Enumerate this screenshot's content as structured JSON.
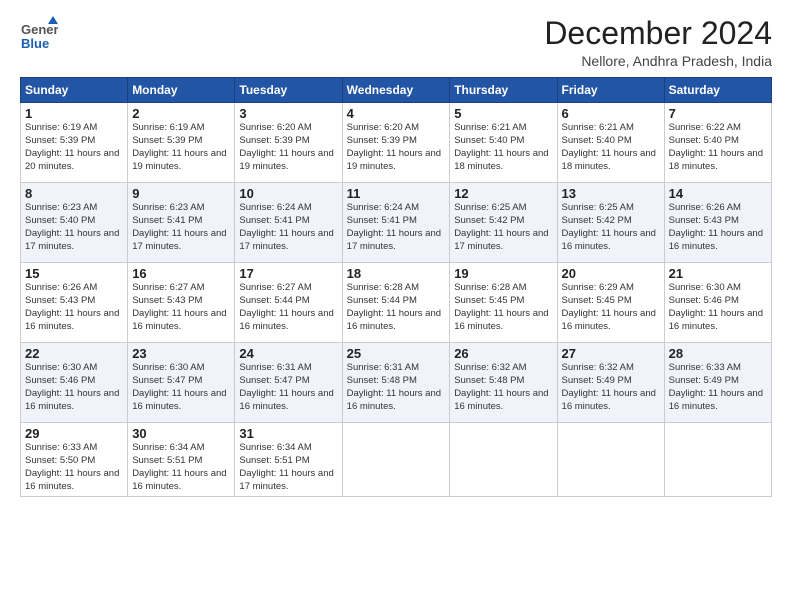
{
  "header": {
    "logo_general": "General",
    "logo_blue": "Blue",
    "month_title": "December 2024",
    "location": "Nellore, Andhra Pradesh, India"
  },
  "weekdays": [
    "Sunday",
    "Monday",
    "Tuesday",
    "Wednesday",
    "Thursday",
    "Friday",
    "Saturday"
  ],
  "weeks": [
    [
      {
        "day": 1,
        "sunrise": "6:19 AM",
        "sunset": "5:39 PM",
        "daylight": "11 hours and 20 minutes."
      },
      {
        "day": 2,
        "sunrise": "6:19 AM",
        "sunset": "5:39 PM",
        "daylight": "11 hours and 19 minutes."
      },
      {
        "day": 3,
        "sunrise": "6:20 AM",
        "sunset": "5:39 PM",
        "daylight": "11 hours and 19 minutes."
      },
      {
        "day": 4,
        "sunrise": "6:20 AM",
        "sunset": "5:39 PM",
        "daylight": "11 hours and 19 minutes."
      },
      {
        "day": 5,
        "sunrise": "6:21 AM",
        "sunset": "5:40 PM",
        "daylight": "11 hours and 18 minutes."
      },
      {
        "day": 6,
        "sunrise": "6:21 AM",
        "sunset": "5:40 PM",
        "daylight": "11 hours and 18 minutes."
      },
      {
        "day": 7,
        "sunrise": "6:22 AM",
        "sunset": "5:40 PM",
        "daylight": "11 hours and 18 minutes."
      }
    ],
    [
      {
        "day": 8,
        "sunrise": "6:23 AM",
        "sunset": "5:40 PM",
        "daylight": "11 hours and 17 minutes."
      },
      {
        "day": 9,
        "sunrise": "6:23 AM",
        "sunset": "5:41 PM",
        "daylight": "11 hours and 17 minutes."
      },
      {
        "day": 10,
        "sunrise": "6:24 AM",
        "sunset": "5:41 PM",
        "daylight": "11 hours and 17 minutes."
      },
      {
        "day": 11,
        "sunrise": "6:24 AM",
        "sunset": "5:41 PM",
        "daylight": "11 hours and 17 minutes."
      },
      {
        "day": 12,
        "sunrise": "6:25 AM",
        "sunset": "5:42 PM",
        "daylight": "11 hours and 17 minutes."
      },
      {
        "day": 13,
        "sunrise": "6:25 AM",
        "sunset": "5:42 PM",
        "daylight": "11 hours and 16 minutes."
      },
      {
        "day": 14,
        "sunrise": "6:26 AM",
        "sunset": "5:43 PM",
        "daylight": "11 hours and 16 minutes."
      }
    ],
    [
      {
        "day": 15,
        "sunrise": "6:26 AM",
        "sunset": "5:43 PM",
        "daylight": "11 hours and 16 minutes."
      },
      {
        "day": 16,
        "sunrise": "6:27 AM",
        "sunset": "5:43 PM",
        "daylight": "11 hours and 16 minutes."
      },
      {
        "day": 17,
        "sunrise": "6:27 AM",
        "sunset": "5:44 PM",
        "daylight": "11 hours and 16 minutes."
      },
      {
        "day": 18,
        "sunrise": "6:28 AM",
        "sunset": "5:44 PM",
        "daylight": "11 hours and 16 minutes."
      },
      {
        "day": 19,
        "sunrise": "6:28 AM",
        "sunset": "5:45 PM",
        "daylight": "11 hours and 16 minutes."
      },
      {
        "day": 20,
        "sunrise": "6:29 AM",
        "sunset": "5:45 PM",
        "daylight": "11 hours and 16 minutes."
      },
      {
        "day": 21,
        "sunrise": "6:30 AM",
        "sunset": "5:46 PM",
        "daylight": "11 hours and 16 minutes."
      }
    ],
    [
      {
        "day": 22,
        "sunrise": "6:30 AM",
        "sunset": "5:46 PM",
        "daylight": "11 hours and 16 minutes."
      },
      {
        "day": 23,
        "sunrise": "6:30 AM",
        "sunset": "5:47 PM",
        "daylight": "11 hours and 16 minutes."
      },
      {
        "day": 24,
        "sunrise": "6:31 AM",
        "sunset": "5:47 PM",
        "daylight": "11 hours and 16 minutes."
      },
      {
        "day": 25,
        "sunrise": "6:31 AM",
        "sunset": "5:48 PM",
        "daylight": "11 hours and 16 minutes."
      },
      {
        "day": 26,
        "sunrise": "6:32 AM",
        "sunset": "5:48 PM",
        "daylight": "11 hours and 16 minutes."
      },
      {
        "day": 27,
        "sunrise": "6:32 AM",
        "sunset": "5:49 PM",
        "daylight": "11 hours and 16 minutes."
      },
      {
        "day": 28,
        "sunrise": "6:33 AM",
        "sunset": "5:49 PM",
        "daylight": "11 hours and 16 minutes."
      }
    ],
    [
      {
        "day": 29,
        "sunrise": "6:33 AM",
        "sunset": "5:50 PM",
        "daylight": "11 hours and 16 minutes."
      },
      {
        "day": 30,
        "sunrise": "6:34 AM",
        "sunset": "5:51 PM",
        "daylight": "11 hours and 16 minutes."
      },
      {
        "day": 31,
        "sunrise": "6:34 AM",
        "sunset": "5:51 PM",
        "daylight": "11 hours and 17 minutes."
      },
      null,
      null,
      null,
      null
    ]
  ]
}
